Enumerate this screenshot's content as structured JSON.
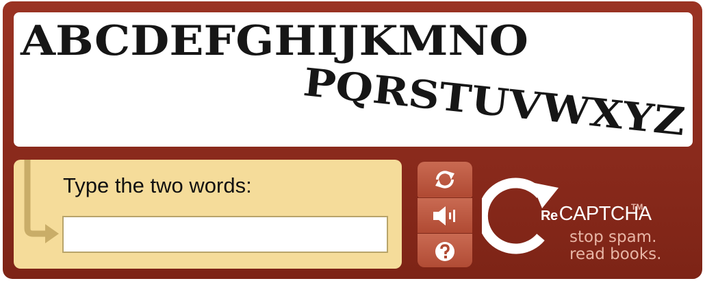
{
  "challenge": {
    "word_one": "ABCDEFGHIJKMNO",
    "word_two": "PQRSTUVWXYZ"
  },
  "answer": {
    "label": "Type the two words:",
    "value": "",
    "placeholder": ""
  },
  "controls": [
    {
      "icon": "refresh-icon"
    },
    {
      "icon": "speaker-icon"
    },
    {
      "icon": "help-icon"
    }
  ],
  "brand": {
    "prefix": "Re",
    "name": "CAPTCHA",
    "tm": "TM",
    "slogan_line1": "stop spam.",
    "slogan_line2": "read books."
  },
  "colors": {
    "frame": "#8a2a1c",
    "answer_panel": "#f5dc9a",
    "button": "#b8503a",
    "slogan": "#e8b6a6"
  }
}
